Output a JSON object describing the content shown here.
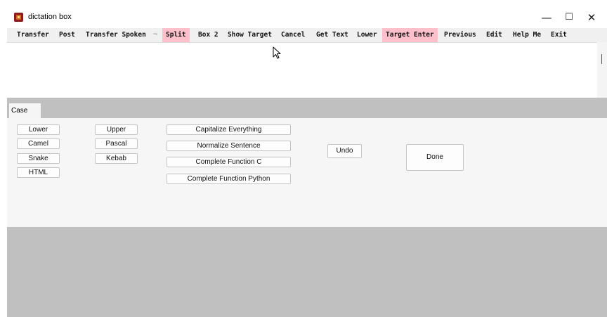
{
  "window": {
    "title": "dictation box",
    "controls": {
      "minimize": "—",
      "maximize": "☐",
      "close": "✕"
    }
  },
  "menubar": {
    "items": [
      {
        "label": "Transfer",
        "highlight": false
      },
      {
        "label": "Post",
        "highlight": false
      },
      {
        "label": "Transfer Spoken",
        "highlight": false
      },
      {
        "label": "Split",
        "highlight": true
      },
      {
        "label": "Box 2",
        "highlight": false
      },
      {
        "label": "Show Target",
        "highlight": false
      },
      {
        "label": "Cancel",
        "highlight": false
      },
      {
        "label": "Get Text",
        "highlight": false
      },
      {
        "label": "Lower",
        "highlight": false
      },
      {
        "label": "Target Enter",
        "highlight": true
      },
      {
        "label": "Previous",
        "highlight": false
      },
      {
        "label": "Edit",
        "highlight": false
      },
      {
        "label": "Help Me",
        "highlight": false
      },
      {
        "label": "Exit",
        "highlight": false
      }
    ],
    "separator": "¬"
  },
  "editor": {
    "value": ""
  },
  "tabs": [
    {
      "label": "Case",
      "active": true
    }
  ],
  "case_panel": {
    "col1": [
      "Lower",
      "Camel",
      "Snake",
      "HTML"
    ],
    "col2": [
      "Upper",
      "Pascal",
      "Kebab"
    ],
    "col3": [
      "Capitalize Everything",
      "Normalize Sentence",
      "Complete Function C",
      "Complete Function Python"
    ],
    "undo": "Undo",
    "done": "Done"
  },
  "colors": {
    "highlight": "#ffc0cb",
    "background": "#c0c0c0",
    "panel": "#f6f6f6"
  }
}
